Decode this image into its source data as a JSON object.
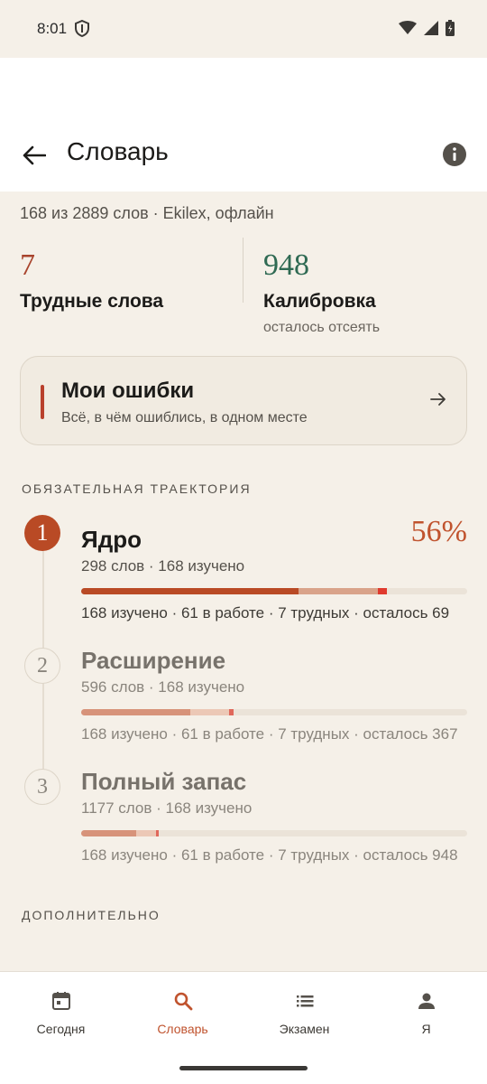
{
  "status_bar": {
    "time": "8:01"
  },
  "header": {
    "title": "Словарь"
  },
  "summary": "168 из 2889 слов · Ekilex, офлайн",
  "stats": {
    "hard": {
      "value": "7",
      "label": "Трудные слова"
    },
    "calibration": {
      "value": "948",
      "label": "Калибровка",
      "sub": "осталось отсеять"
    }
  },
  "mistakes": {
    "title": "Мои ошибки",
    "subtitle": "Всё, в чём ошиблись, в одном месте"
  },
  "trajectory": {
    "label": "ОБЯЗАТЕЛЬНАЯ ТРАЕКТОРИЯ",
    "steps": [
      {
        "num": "1",
        "title": "Ядро",
        "meta": "298 слов · 168 изучено",
        "percent": "56%",
        "breakdown": "168 изучено · 61 в работе · 7 трудных · осталось 69",
        "progress": {
          "learned": 168,
          "in_work": 61,
          "hard": 7,
          "total": 298
        }
      },
      {
        "num": "2",
        "title": "Расширение",
        "meta": "596 слов · 168 изучено",
        "breakdown": "168 изучено · 61 в работе · 7 трудных · осталось 367",
        "progress": {
          "learned": 168,
          "in_work": 61,
          "hard": 7,
          "total": 596
        }
      },
      {
        "num": "3",
        "title": "Полный запас",
        "meta": "1177 слов · 168 изучено",
        "breakdown": "168 изучено · 61 в работе · 7 трудных · осталось 948",
        "progress": {
          "learned": 168,
          "in_work": 61,
          "hard": 7,
          "total": 1177
        }
      }
    ]
  },
  "additional": {
    "label": "ДОПОЛНИТЕЛЬНО"
  },
  "bottom_nav": {
    "items": [
      {
        "label": "Сегодня",
        "icon": "calendar-icon"
      },
      {
        "label": "Словарь",
        "icon": "search-icon",
        "selected": true
      },
      {
        "label": "Экзамен",
        "icon": "list-icon"
      },
      {
        "label": "Я",
        "icon": "person-icon"
      }
    ]
  },
  "colors": {
    "accent": "#c0532e",
    "hard_accent": "#a8432c",
    "calibration": "#2f6a53",
    "background": "#f5f0e8"
  }
}
